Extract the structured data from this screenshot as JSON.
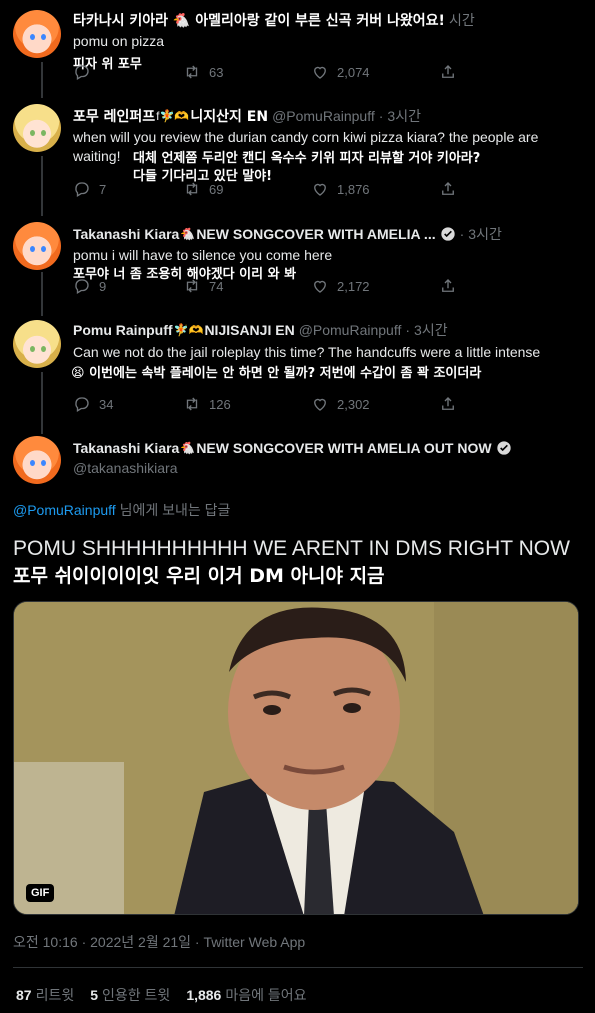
{
  "colors": {
    "background": "#000000",
    "text": "#e7e9ea",
    "muted": "#71767b",
    "link": "#1d9bf0",
    "border": "#2f3336"
  },
  "tweets": [
    {
      "header_overlay": "타카나시 키아라 🐔 아멜리아랑 같이 부른 신곡 커버 나왔어요!",
      "time_partial": "시간",
      "text": "pomu on pizza",
      "subtitle": "피자 위 포무",
      "replies": "",
      "retweets": "63",
      "likes": "2,074"
    },
    {
      "name_overlay": "포무 레인퍼프",
      "name_suffix": "니지산지 EN",
      "handle": "@PomuRainpuff",
      "time": "3시간",
      "text": "when will you review the durian candy corn kiwi pizza kiara? the people are waiting!",
      "subtitle_1": "대체 언제쯤 두리안 캔디 옥수수 키위 피자 리뷰할 거야 키아라?",
      "subtitle_2": "다들 기다리고 있단 말야!",
      "replies": "7",
      "retweets": "69",
      "likes": "1,876"
    },
    {
      "name": "Takanashi Kiara",
      "name_suffix": "NEW SONGCOVER WITH AMELIA ...",
      "time": "3시간",
      "text": "pomu i will have to silence you come here",
      "subtitle": "포무야 너 좀 조용히 해야겠다 이리 와 봐",
      "replies": "9",
      "retweets": "74",
      "likes": "2,172"
    },
    {
      "name": "Pomu Rainpuff",
      "name_suffix": "NIJISANJI EN",
      "handle": "@PomuRainpuff",
      "time": "3시간",
      "text": "Can we not do the jail roleplay this time? The handcuffs were a little intense",
      "subtitle": "😫 이번에는 속박 플레이는 안 하면 안 될까? 저번에 수갑이 좀 꽉 조이더라",
      "replies": "34",
      "retweets": "126",
      "likes": "2,302"
    }
  ],
  "main": {
    "name": "Takanashi Kiara",
    "name_suffix": "NEW SONGCOVER WITH AMELIA OUT NOW",
    "handle": "@takanashikiara",
    "replying_to": "@PomuRainpuff",
    "replying_suffix": "님에게 보내는 답글",
    "text": "POMU SHHHHHHHHHH WE ARENT IN DMS RIGHT NOW",
    "subtitle": "포무 쉬이이이이잇 우리 이거 DM 아니야 지금",
    "gif_label": "GIF",
    "timestamp": "오전 10:16 · 2022년 2월 21일 · Twitter Web App",
    "retweets_count": "87",
    "retweets_label": "리트윗",
    "quotes_count": "5",
    "quotes_label": "인용한 트윗",
    "likes_count": "1,886",
    "likes_label": "마음에 들어요"
  }
}
